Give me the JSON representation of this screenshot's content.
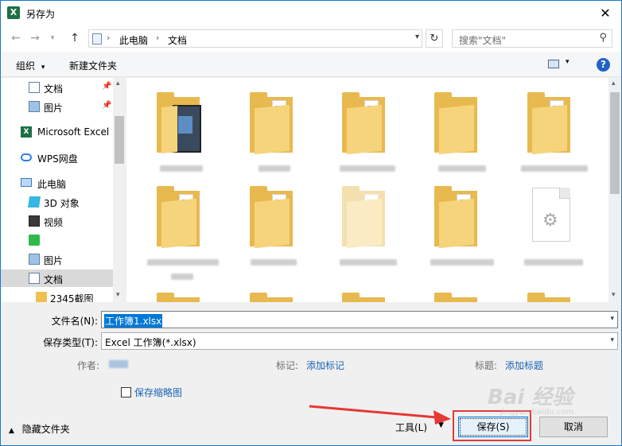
{
  "window": {
    "title": "另存为",
    "app_icon": "X"
  },
  "address": {
    "crumbs": [
      "此电脑",
      "文档"
    ],
    "search_placeholder": "搜索\"文档\""
  },
  "toolbar": {
    "organize": "组织",
    "new_folder": "新建文件夹",
    "help": "?"
  },
  "nav_items": [
    {
      "label": "文档",
      "icon": "document-icon",
      "pinned": true
    },
    {
      "label": "图片",
      "icon": "picture-icon",
      "pinned": true
    },
    {
      "label": "Microsoft Excel",
      "icon": "excel-icon"
    },
    {
      "label": "WPS网盘",
      "icon": "cloud-icon"
    },
    {
      "label": "此电脑",
      "icon": "computer-icon"
    },
    {
      "label": "3D 对象",
      "icon": "3d-objects-icon"
    },
    {
      "label": "视频",
      "icon": "video-icon"
    },
    {
      "label": "",
      "icon": "app-icon"
    },
    {
      "label": "图片",
      "icon": "picture-icon"
    },
    {
      "label": "文档",
      "icon": "document-icon",
      "selected": true
    },
    {
      "label": "2345截图",
      "icon": "folder-icon"
    }
  ],
  "form": {
    "filename_label": "文件名(N):",
    "filename_value": "工作簿1.xlsx",
    "type_label": "保存类型(T):",
    "type_value": "Excel 工作簿(*.xlsx)",
    "author_label": "作者:",
    "tags_label": "标记:",
    "tags_link": "添加标记",
    "title_label": "标题:",
    "title_link": "添加标题",
    "thumbnail_label": "保存缩略图"
  },
  "footer": {
    "hide_folders": "隐藏文件夹",
    "tools": "工具(L)",
    "save": "保存(S)",
    "cancel": "取消"
  },
  "watermark": {
    "text": "Bai 经验",
    "sub": "jingyan.baidu.com"
  },
  "colors": {
    "accent": "#0078d7",
    "link": "#1a63b5",
    "highlight": "#e03a3a"
  }
}
